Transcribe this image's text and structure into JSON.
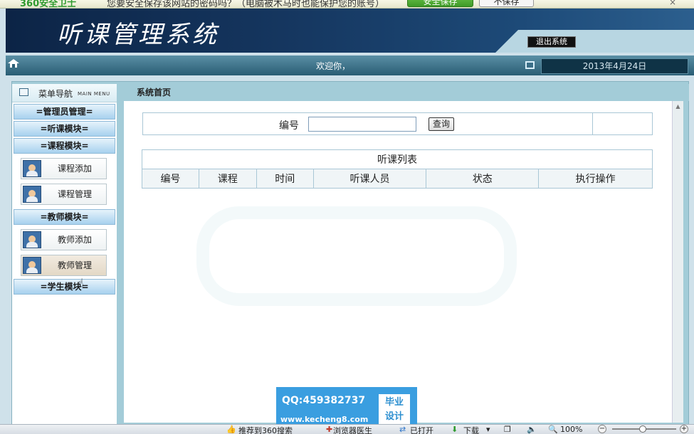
{
  "notify": {
    "brand": "360安全卫士",
    "message": "您要安全保存该网站的密码吗？（电脑被木马时也能保护您的账号）",
    "safe_button": "安全保存",
    "cont_button": "不保存",
    "close": "×"
  },
  "app": {
    "title": "听课管理系统",
    "logout_label": "退出系统"
  },
  "welcome": {
    "text": "欢迎你，",
    "date": "2013年4月24日"
  },
  "sidebar": {
    "header_label": "菜单导航",
    "header_sub": "MAIN MENU",
    "sections": [
      {
        "title": "=管理员管理=",
        "items": []
      },
      {
        "title": "=听课模块=",
        "items": []
      },
      {
        "title": "=课程模块=",
        "items": [
          "课程添加",
          "课程管理"
        ]
      },
      {
        "title": "=教师模块=",
        "items": [
          "教师添加",
          "教师管理"
        ]
      },
      {
        "title": "=学生模块=",
        "items": []
      }
    ]
  },
  "breadcrumb": "系统首页",
  "search": {
    "label": "编号",
    "value": "",
    "button": "查询"
  },
  "table": {
    "caption": "听课列表",
    "columns": [
      "编号",
      "课程",
      "时间",
      "听课人员",
      "状态",
      "执行操作"
    ],
    "rows": []
  },
  "watermark": {
    "qq": "QQ:459382737",
    "site": "www.kecheng8.com",
    "tag_line1": "毕业",
    "tag_line2": "设计"
  },
  "statusbar": {
    "recommend": "推荐到360搜索",
    "browser": "浏览器医生",
    "opened": "已打开",
    "download": "下载",
    "zoom": "100%"
  }
}
